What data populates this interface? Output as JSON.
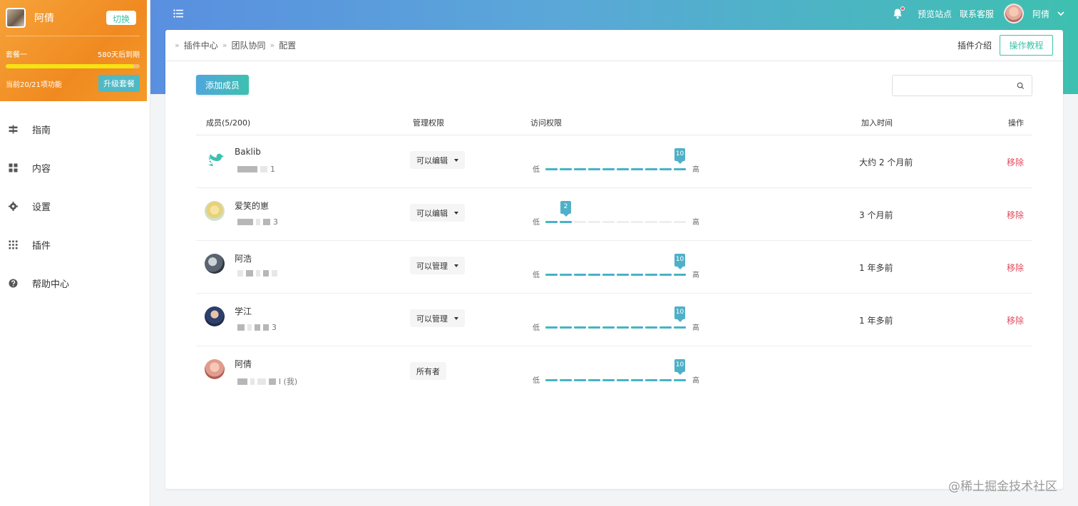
{
  "account": {
    "name": "阿倩",
    "switch_label": "切换",
    "plan_name": "套餐一",
    "expiry": "580天后到期",
    "plan_progress_pct": 96,
    "features": "当前20/21项功能",
    "upgrade_label": "升级套餐"
  },
  "nav": [
    {
      "label": "指南",
      "icon": "signpost-icon"
    },
    {
      "label": "内容",
      "icon": "grid-icon"
    },
    {
      "label": "设置",
      "icon": "gear-icon"
    },
    {
      "label": "插件",
      "icon": "apps-icon"
    },
    {
      "label": "帮助中心",
      "icon": "help-icon"
    }
  ],
  "topbar": {
    "preview": "预览站点",
    "support": "联系客服",
    "user": "阿倩"
  },
  "breadcrumb": [
    "插件中心",
    "团队协同",
    "配置"
  ],
  "header": {
    "intro": "插件介绍",
    "tutorial": "操作教程"
  },
  "toolbar": {
    "add_label": "添加成员",
    "search_placeholder": ""
  },
  "table": {
    "headers": {
      "member": "成员(5/200)",
      "role": "管理权限",
      "access": "访问权限",
      "joined": "加入时间",
      "action": "操作"
    },
    "low": "低",
    "high": "高",
    "rows": [
      {
        "name": "Baklib",
        "sub": "1",
        "role": "可以编辑",
        "has_dropdown": true,
        "level": 10,
        "joined": "大约 2 个月前",
        "action": "移除"
      },
      {
        "name": "爱笑的崽",
        "sub": "3",
        "role": "可以编辑",
        "has_dropdown": true,
        "level": 2,
        "joined": "3 个月前",
        "action": "移除"
      },
      {
        "name": "阿浩",
        "sub": "",
        "role": "可以管理",
        "has_dropdown": true,
        "level": 10,
        "joined": "1 年多前",
        "action": "移除"
      },
      {
        "name": "学江",
        "sub": "3",
        "role": "可以管理",
        "has_dropdown": true,
        "level": 10,
        "joined": "1 年多前",
        "action": "移除"
      },
      {
        "name": "阿倩",
        "sub": "l (我)",
        "role": "所有者",
        "has_dropdown": false,
        "level": 10,
        "joined": "",
        "action": ""
      }
    ]
  },
  "watermark": "@稀土掘金技术社区",
  "colors": {
    "accent": "#3cc3a8",
    "danger": "#e0495c",
    "orange": "#f08a20"
  }
}
